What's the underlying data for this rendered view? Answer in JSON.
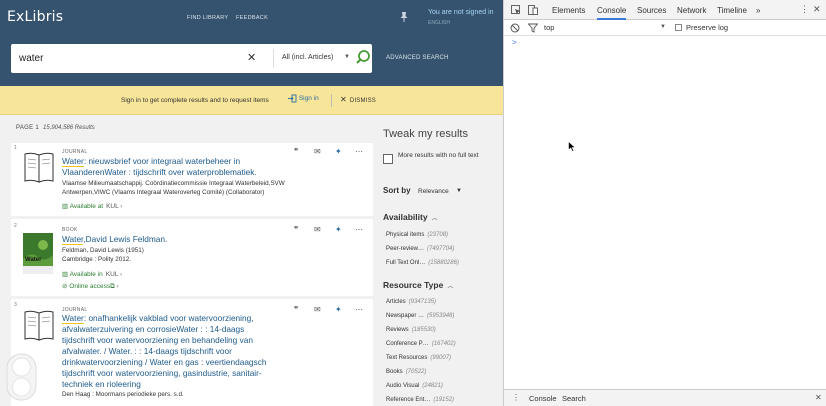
{
  "header": {
    "logo": "ExLibris",
    "nav_find_library": "FIND LIBRARY",
    "nav_feedback": "FEEDBACK",
    "signin_status": "You are not signed in",
    "language": "ENGLISH",
    "colors": {
      "header_bg": "#35536f",
      "banner_bg": "#f7e59a",
      "link": "#1e5b8c",
      "available": "#2e7d32"
    }
  },
  "search": {
    "query": "water",
    "scope": "All (incl. Articles)",
    "advanced": "ADVANCED SEARCH"
  },
  "banner": {
    "message": "Sign in to get complete results and to request items",
    "signin": "Sign in",
    "dismiss": "DISMISS"
  },
  "results_info": {
    "page": "PAGE 1",
    "count": "15,904,586 Results"
  },
  "results": [
    {
      "num": "1",
      "type": "JOURNAL",
      "title_hl": "Water",
      "title_rest": ": nieuwsbrief voor integraal waterbeheer in VlaanderenWater : tijdschrift over waterproblematiek.",
      "meta1": "Vlaamse Milieumaatschappij. Coördinatiecommissie Integraal Waterbeleid,SVW",
      "meta2": "Antwerpen,VIWC (Vlaams Integraal Wateroverleg Comité) (Collaborator)",
      "availability": "Available at",
      "library": "KUL"
    },
    {
      "num": "2",
      "type": "BOOK",
      "title_hl": "Water",
      "title_rest": ",David Lewis Feldman.",
      "meta1": "Feldman, David Lewis (1951)",
      "meta2": "Cambridge : Polity 2012.",
      "availability": "Available in",
      "library": "KUL",
      "online": "Online access",
      "cover_text": "Water"
    },
    {
      "num": "3",
      "type": "JOURNAL",
      "title_hl": "Water",
      "title_rest": ": onafhankelijk vakblad voor watervoorziening, afvalwaterzuivering en corrosieWater : : 14-daags tijdschrift voor watervoorziening en behandeling van afvalwater. / Water. : : 14-daags tijdschrift voor drinkwatervoorziening / Water en gas : veertiendaagsch tijdschrift voor watervoorziening, gasindustrie, sanitair-techniek en rioleering",
      "meta1": "Den Haag : Moormans periodieke pers. s.d."
    }
  ],
  "tweak": {
    "title": "Tweak my results",
    "more_results": "More results with no full text",
    "sort_by": "Sort by",
    "sort_value": "Relevance",
    "availability_head": "Availability",
    "availability_items": [
      {
        "label": "Physical items",
        "count": "(23708)"
      },
      {
        "label": "Peer-review…",
        "count": "(7497704)"
      },
      {
        "label": "Full Text Onl…",
        "count": "(15880286)"
      }
    ],
    "resource_head": "Resource Type",
    "resource_items": [
      {
        "label": "Articles",
        "count": "(9347135)"
      },
      {
        "label": "Newspaper …",
        "count": "(5953948)"
      },
      {
        "label": "Reviews",
        "count": "(185530)"
      },
      {
        "label": "Conference P…",
        "count": "(167402)"
      },
      {
        "label": "Text Resources",
        "count": "(99007)"
      },
      {
        "label": "Books",
        "count": "(70522)"
      },
      {
        "label": "Audio Visual",
        "count": "(24821)"
      },
      {
        "label": "Reference Ent…",
        "count": "(19152)"
      }
    ]
  },
  "devtools": {
    "tabs": [
      "Elements",
      "Console",
      "Sources",
      "Network",
      "Timeline"
    ],
    "more": "»",
    "context": "top",
    "preserve_log": "Preserve log",
    "prompt": ">",
    "drawer_console": "Console",
    "drawer_search": "Search"
  }
}
